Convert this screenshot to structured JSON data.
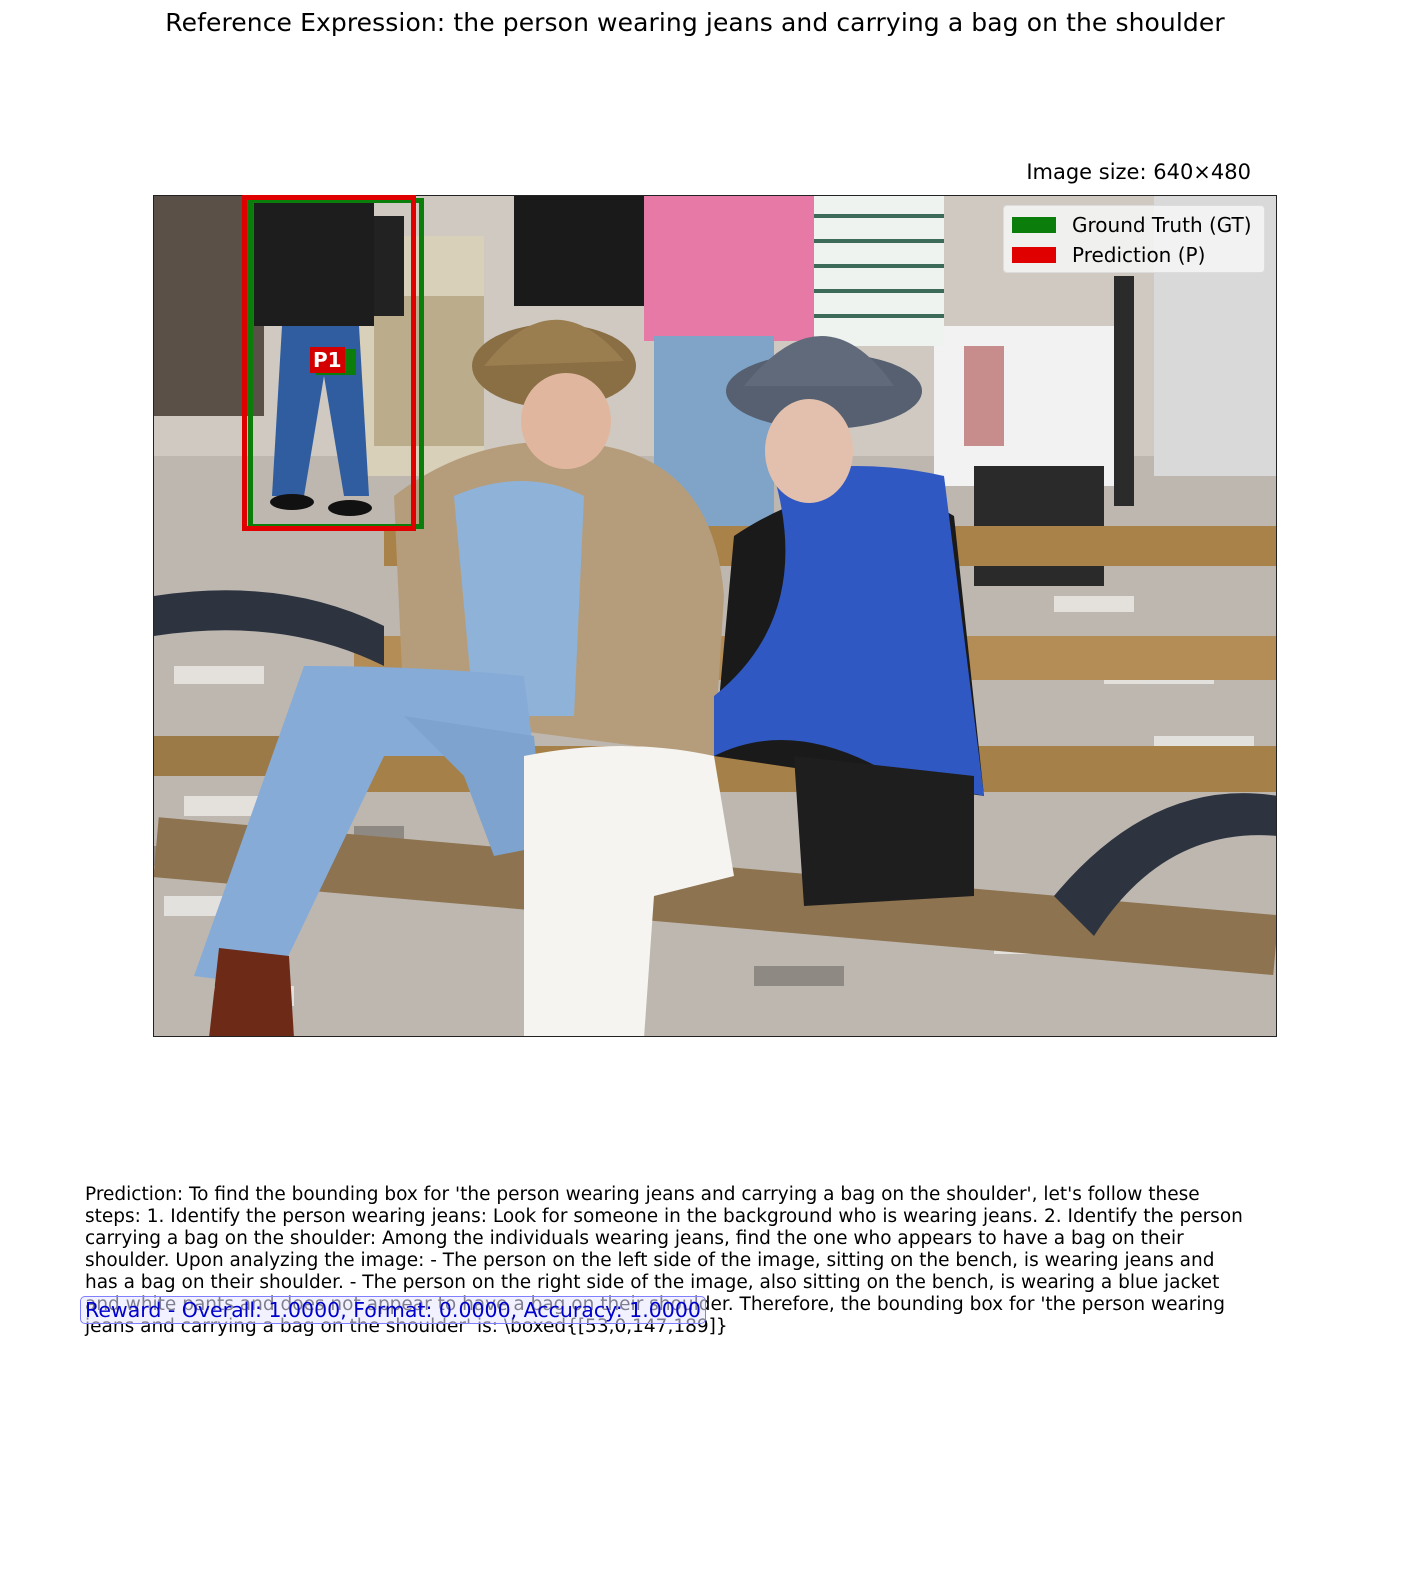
{
  "header": {
    "reference_expression": "Reference Expression: the person wearing jeans and carrying a bag on the shoulder",
    "image_size": "Image size: 640×480"
  },
  "legend": {
    "ground_truth": "Ground Truth (GT)",
    "prediction": "Prediction (P)",
    "colors": {
      "ground_truth": "#0a7d0a",
      "prediction": "#e00000"
    }
  },
  "boxes": {
    "prediction_tag": "P1"
  },
  "prediction_text": "Prediction: To find the bounding box for 'the person wearing jeans and carrying a bag on the shoulder', let's follow these steps:  1. Identify the person wearing jeans: Look for someone in the background who is wearing jeans. 2. Identify the person carrying a bag on the shoulder: Among the individuals wearing jeans, find the one who appears to have a bag on their shoulder.  Upon analyzing the image: - The person on the left side of the image, sitting on the bench, is wearing jeans and has a bag on their shoulder. - The person on the right side of the image, also sitting on the bench, is wearing a blue jacket and white pants and does not appear to have a bag on their shoulder.  Therefore, the bounding box for 'the person wearing jeans and carrying a bag on the shoulder' is: \\boxed{[53,0,147,189]}",
  "reward": "Reward - Overall: 1.0000, Format: 0.0000, Accuracy: 1.0000"
}
